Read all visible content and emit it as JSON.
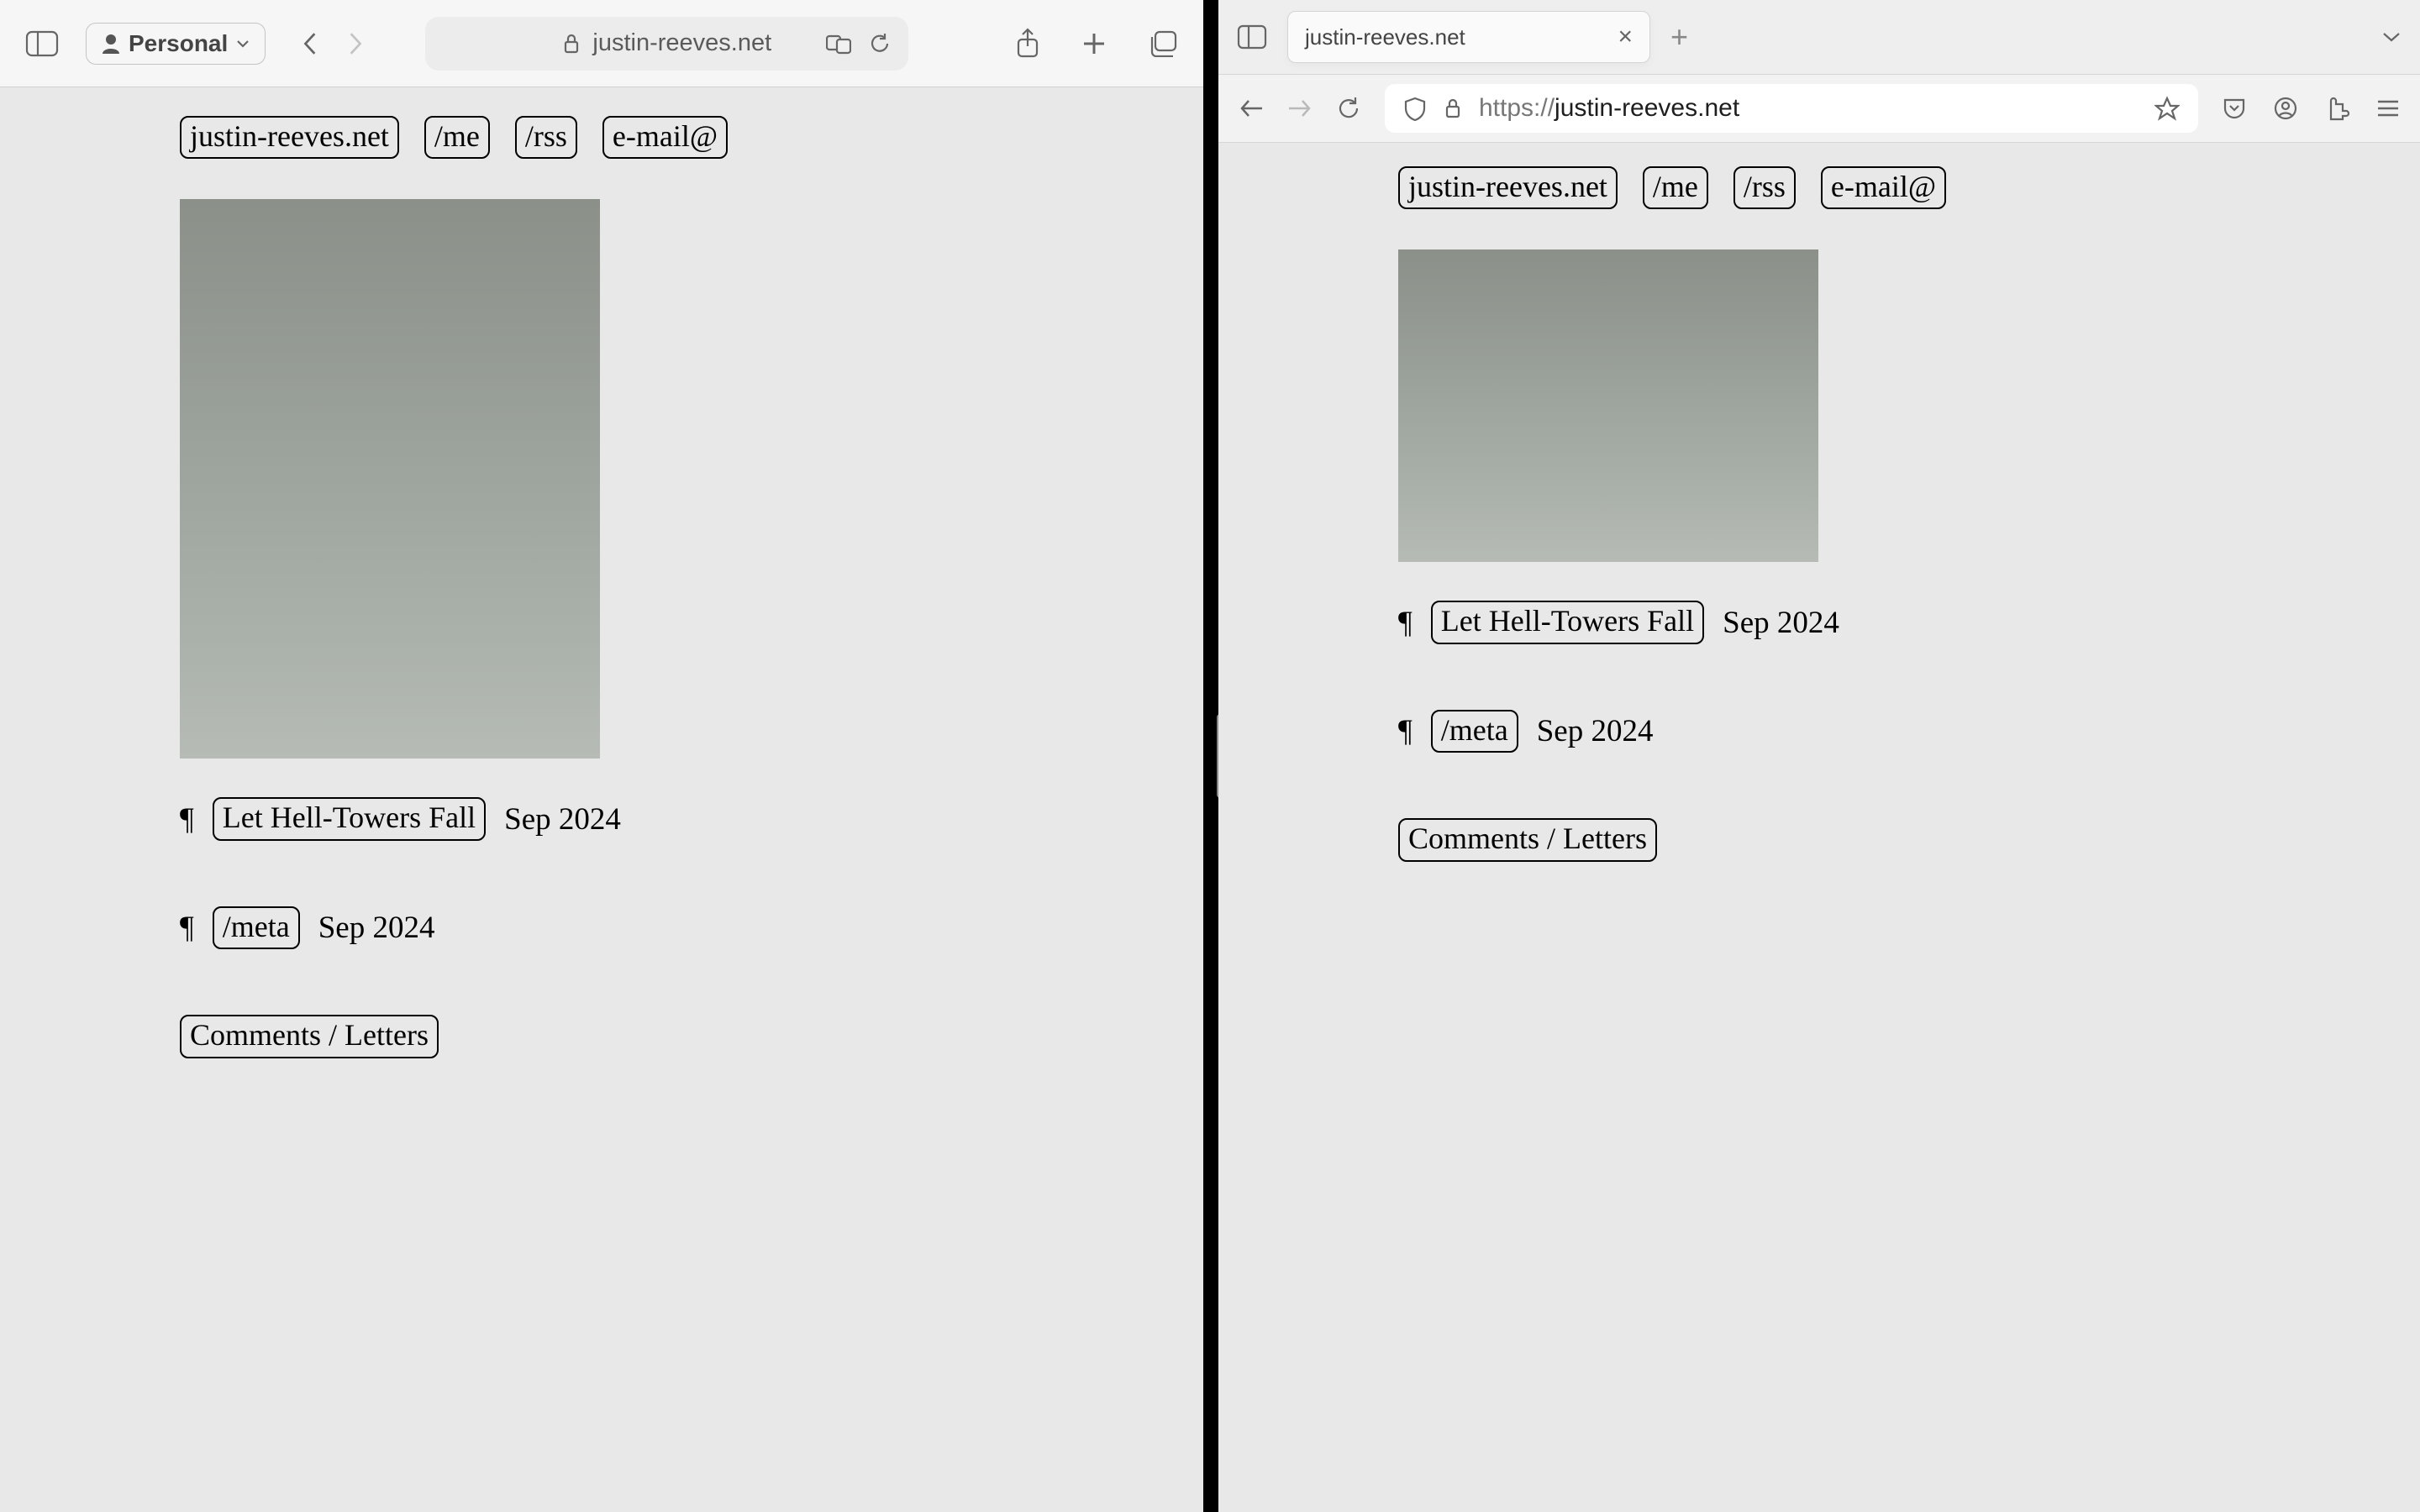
{
  "safari": {
    "profile_label": "Personal",
    "url_display": "justin-reeves.net"
  },
  "firefox": {
    "tab_title": "justin-reeves.net",
    "url_scheme": "https://",
    "url_host": "justin-reeves.net"
  },
  "site": {
    "nav": [
      "justin-reeves.net",
      "/me",
      "/rss",
      "e-mail@"
    ],
    "posts": [
      {
        "title": "Let Hell-Towers Fall",
        "date": "Sep 2024"
      },
      {
        "title": "/meta",
        "date": "Sep 2024"
      }
    ],
    "comments_label": "Comments / Letters",
    "pilcrow": "¶"
  }
}
